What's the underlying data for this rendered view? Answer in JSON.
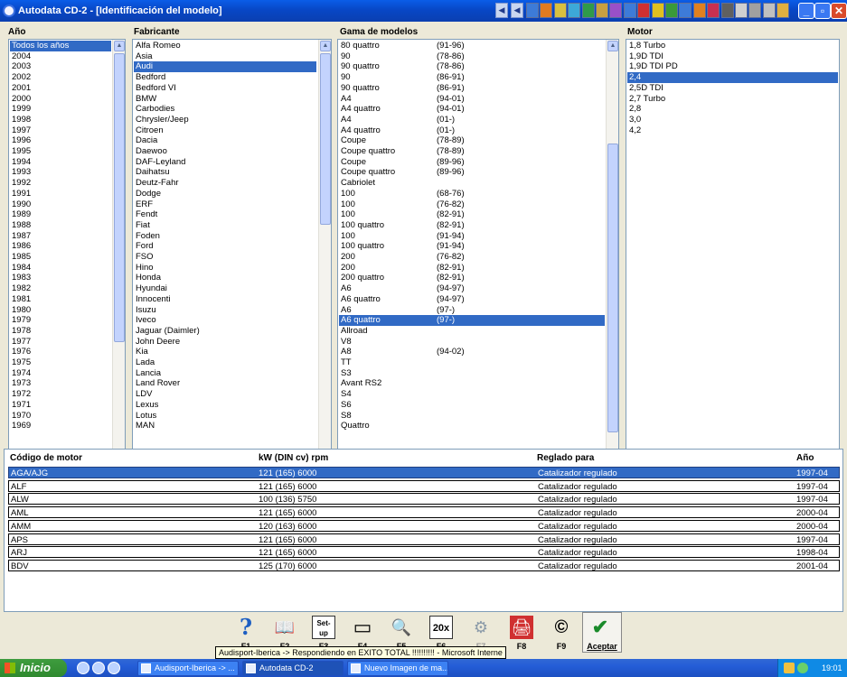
{
  "window": {
    "title": "Autodata CD-2 - [Identificación del modelo]"
  },
  "panes": {
    "year": {
      "header": "Año",
      "items": [
        "Todos los años",
        "2004",
        "2003",
        "2002",
        "2001",
        "2000",
        "1999",
        "1998",
        "1997",
        "1996",
        "1995",
        "1994",
        "1993",
        "1992",
        "1991",
        "1990",
        "1989",
        "1988",
        "1987",
        "1986",
        "1985",
        "1984",
        "1983",
        "1982",
        "1981",
        "1980",
        "1979",
        "1978",
        "1977",
        "1976",
        "1975",
        "1974",
        "1973",
        "1972",
        "1971",
        "1970",
        "1969"
      ],
      "selected_index": 0
    },
    "manufacturer": {
      "header": "Fabricante",
      "items": [
        "Alfa Romeo",
        "Asia",
        "Audi",
        "Bedford",
        "Bedford VI",
        "BMW",
        "Carbodies",
        "Chrysler/Jeep",
        "Citroen",
        "Dacia",
        "Daewoo",
        "DAF-Leyland",
        "Daihatsu",
        "Deutz-Fahr",
        "Dodge",
        "ERF",
        "Fendt",
        "Fiat",
        "Foden",
        "Ford",
        "FSO",
        "Hino",
        "Honda",
        "Hyundai",
        "Innocenti",
        "Isuzu",
        "Iveco",
        "Jaguar (Daimler)",
        "John Deere",
        "Kia",
        "Lada",
        "Lancia",
        "Land Rover",
        "LDV",
        "Lexus",
        "Lotus",
        "MAN"
      ],
      "selected_index": 2
    },
    "models": {
      "header": "Gama de modelos",
      "items": [
        [
          "80 quattro",
          "(91-96)"
        ],
        [
          "90",
          "(78-86)"
        ],
        [
          "90 quattro",
          "(78-86)"
        ],
        [
          "90",
          "(86-91)"
        ],
        [
          "90 quattro",
          "(86-91)"
        ],
        [
          "A4",
          "(94-01)"
        ],
        [
          "A4 quattro",
          "(94-01)"
        ],
        [
          "A4",
          "(01-)"
        ],
        [
          "A4 quattro",
          "(01-)"
        ],
        [
          "Coupe",
          "(78-89)"
        ],
        [
          "Coupe quattro",
          "(78-89)"
        ],
        [
          "Coupe",
          "(89-96)"
        ],
        [
          "Coupe quattro",
          "(89-96)"
        ],
        [
          "Cabriolet",
          ""
        ],
        [
          "100",
          "(68-76)"
        ],
        [
          "100",
          "(76-82)"
        ],
        [
          "100",
          "(82-91)"
        ],
        [
          "100 quattro",
          "(82-91)"
        ],
        [
          "100",
          "(91-94)"
        ],
        [
          "100 quattro",
          "(91-94)"
        ],
        [
          "200",
          "(76-82)"
        ],
        [
          "200",
          "(82-91)"
        ],
        [
          "200 quattro",
          "(82-91)"
        ],
        [
          "A6",
          "(94-97)"
        ],
        [
          "A6 quattro",
          "(94-97)"
        ],
        [
          "A6",
          "(97-)"
        ],
        [
          "A6 quattro",
          "(97-)"
        ],
        [
          "Allroad",
          ""
        ],
        [
          "V8",
          ""
        ],
        [
          "A8",
          "(94-02)"
        ],
        [
          "TT",
          ""
        ],
        [
          "S3",
          ""
        ],
        [
          "Avant RS2",
          ""
        ],
        [
          "S4",
          ""
        ],
        [
          "S6",
          ""
        ],
        [
          "S8",
          ""
        ],
        [
          "Quattro",
          ""
        ]
      ],
      "selected_index": 26
    },
    "engine": {
      "header": "Motor",
      "items": [
        "1,8 Turbo",
        "1,9D TDI",
        "1,9D TDI PD",
        "2,4",
        "2,5D TDI",
        "2,7 Turbo",
        "2,8",
        "3,0",
        "4,2"
      ],
      "selected_index": 3
    }
  },
  "engine_table": {
    "columns": [
      "Código de motor",
      "kW (DIN cv) rpm",
      "Reglado para",
      "Año"
    ],
    "rows": [
      [
        "AGA/AJG",
        "121 (165) 6000",
        "Catalizador regulado",
        "1997-04"
      ],
      [
        "ALF",
        "121 (165) 6000",
        "Catalizador regulado",
        "1997-04"
      ],
      [
        "ALW",
        "100 (136) 5750",
        "Catalizador regulado",
        "1997-04"
      ],
      [
        "AML",
        "121 (165) 6000",
        "Catalizador regulado",
        "2000-04"
      ],
      [
        "AMM",
        "120 (163) 6000",
        "Catalizador regulado",
        "2000-04"
      ],
      [
        "APS",
        "121 (165) 6000",
        "Catalizador regulado",
        "1997-04"
      ],
      [
        "ARJ",
        "121 (165) 6000",
        "Catalizador regulado",
        "1998-04"
      ],
      [
        "BDV",
        "125 (170) 6000",
        "Catalizador regulado",
        "2001-04"
      ]
    ],
    "selected_index": 0
  },
  "toolbar": {
    "buttons": [
      {
        "id": "help",
        "icon": "?",
        "label": "F1"
      },
      {
        "id": "book",
        "icon": "📖",
        "label": "F2"
      },
      {
        "id": "setup",
        "icon": "Set-up",
        "label": "F3"
      },
      {
        "id": "screen",
        "icon": "▭",
        "label": "F4"
      },
      {
        "id": "search",
        "icon": "🔍",
        "label": "F5"
      },
      {
        "id": "zoom",
        "icon": "20x",
        "label": "F6"
      },
      {
        "id": "f7",
        "icon": "⚙",
        "label": "F7"
      },
      {
        "id": "print",
        "icon": "🖨",
        "label": "F8"
      },
      {
        "id": "copyright",
        "icon": "©",
        "label": "F9"
      },
      {
        "id": "accept",
        "icon": "✔",
        "label": "Aceptar"
      }
    ]
  },
  "tooltip": "Audisport-Iberica -> Respondiendo en EXITO TOTAL !!!!!!!!!! - Microsoft Interne",
  "taskbar": {
    "start": "Inicio",
    "tasks": [
      "Audisport-Iberica -> ...",
      "Autodata CD-2",
      "Nuevo Imagen de ma..."
    ],
    "active_task": 1,
    "clock": "19:01"
  }
}
